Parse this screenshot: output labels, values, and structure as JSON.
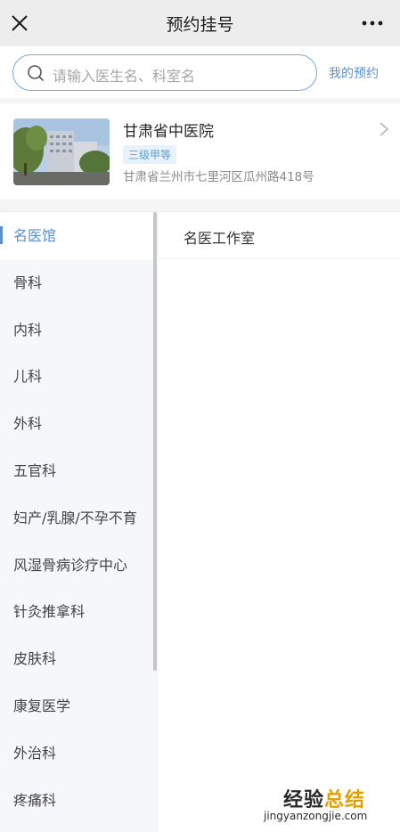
{
  "header": {
    "title": "预约挂号"
  },
  "search": {
    "placeholder": "请输入医生名、科室名",
    "my_appointments": "我的预约"
  },
  "hospital": {
    "name": "甘肃省中医院",
    "level": "三级甲等",
    "address": "甘肃省兰州市七里河区瓜州路418号"
  },
  "sidebar": {
    "items": [
      {
        "label": "名医馆",
        "active": true
      },
      {
        "label": "骨科"
      },
      {
        "label": "内科"
      },
      {
        "label": "儿科"
      },
      {
        "label": "外科"
      },
      {
        "label": "五官科"
      },
      {
        "label": "妇产/乳腺/不孕不育"
      },
      {
        "label": "风湿骨病诊疗中心"
      },
      {
        "label": "针灸推拿科"
      },
      {
        "label": "皮肤科"
      },
      {
        "label": "康复医学"
      },
      {
        "label": "外治科"
      },
      {
        "label": "疼痛科"
      }
    ]
  },
  "content": {
    "rows": [
      {
        "label": "名医工作室"
      }
    ]
  },
  "watermark": {
    "title_part1": "经验",
    "title_part2": "总结",
    "url": "jingyanzongjie.com"
  },
  "colors": {
    "accent": "#5a8fd0",
    "topbar": "#ededed",
    "sidebar_bg": "#f5f7fa",
    "level_bg": "#e8f2fb"
  }
}
